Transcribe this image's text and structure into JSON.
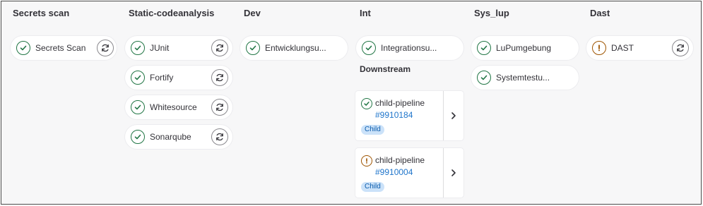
{
  "stages": [
    {
      "title": "Secrets scan",
      "jobs": [
        {
          "name": "Secrets Scan",
          "status": "success",
          "status_icon": "check-circle-icon",
          "retry_icon": "retry-icon"
        }
      ]
    },
    {
      "title": "Static-codeanalysis",
      "jobs": [
        {
          "name": "JUnit",
          "status": "success",
          "status_icon": "check-circle-icon",
          "retry_icon": "retry-icon"
        },
        {
          "name": "Fortify",
          "status": "success",
          "status_icon": "check-circle-icon",
          "retry_icon": "retry-icon"
        },
        {
          "name": "Whitesource",
          "status": "success",
          "status_icon": "check-circle-icon",
          "retry_icon": "retry-icon"
        },
        {
          "name": "Sonarqube",
          "status": "success",
          "status_icon": "check-circle-icon",
          "retry_icon": "retry-icon"
        }
      ]
    },
    {
      "title": "Dev",
      "jobs": [
        {
          "name": "Entwicklungsu...",
          "status": "success",
          "status_icon": "check-circle-icon"
        }
      ]
    },
    {
      "title": "Int",
      "jobs": [
        {
          "name": "Integrationsu...",
          "status": "success",
          "status_icon": "check-circle-icon"
        }
      ]
    },
    {
      "title": "Sys_lup",
      "jobs": [
        {
          "name": "LuPumgebung",
          "status": "success",
          "status_icon": "check-circle-icon"
        },
        {
          "name": "Systemtestu...",
          "status": "success",
          "status_icon": "check-circle-icon"
        }
      ]
    },
    {
      "title": "Dast",
      "jobs": [
        {
          "name": "DAST",
          "status": "warning",
          "status_icon": "warning-circle-icon",
          "retry_icon": "retry-icon"
        }
      ]
    }
  ],
  "downstream": {
    "label": "Downstream",
    "pipelines": [
      {
        "name": "child-pipeline",
        "id": "#9910184",
        "badge": "Child",
        "status": "success",
        "status_icon": "check-circle-icon",
        "expand_icon": "chevron-right-icon"
      },
      {
        "name": "child-pipeline",
        "id": "#9910004",
        "badge": "Child",
        "status": "warning",
        "status_icon": "warning-circle-icon",
        "expand_icon": "chevron-right-icon"
      }
    ]
  },
  "colors": {
    "success": "#217645",
    "warning": "#9e5400",
    "link": "#1f75cb",
    "badge_bg": "#cbe2f9"
  }
}
